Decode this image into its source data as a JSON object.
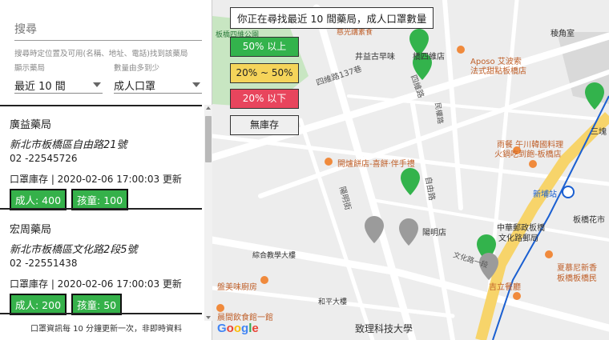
{
  "search": {
    "placeholder": "搜尋",
    "hint": "搜尋時定位置及可用(名稱、地址、電話)找到該藥局"
  },
  "filters": {
    "display": {
      "label": "顯示藥局",
      "value": "最近 10 間"
    },
    "sort": {
      "label": "數量由多到少",
      "value": "成人口罩"
    }
  },
  "stores": [
    {
      "name": "廣益藥局",
      "address": "新北市板橋區自由路21號",
      "phone": "02 -22545726",
      "update": "口罩庫存 | 2020-02-06 17:00:03 更新",
      "adult": "成人: 400",
      "child": "孩童: 100"
    },
    {
      "name": "宏周藥局",
      "address": "新北市板橋區文化路2段5號",
      "phone": "02 -22551438",
      "update": "口罩庫存 | 2020-02-06 17:00:03 更新",
      "adult": "成人: 200",
      "child": "孩童: 50"
    }
  ],
  "footer": "口罩資訊每 10 分鐘更新一次，非即時資料",
  "map": {
    "title": "你正在尋找最近 10 間藥局，成人口罩數量",
    "legend": {
      "green": "50% 以上",
      "yellow": "20% ~ 50%",
      "red": "20% 以下",
      "none": "無庫存"
    },
    "legend_colors": {
      "green": "#33b34c",
      "yellow": "#f5d45a",
      "red": "#e8455d",
      "none": "#efefef"
    },
    "labels": {
      "l1": "四維路137巷",
      "l2": "井益古早味",
      "l3": "橋四維店",
      "l4": "四維路",
      "l5": "Aposo 艾波索",
      "l6": "法式甜點板橋店",
      "l7": "稜角室",
      "l8": "開爐餅店-喜餅·伴手禮",
      "l9": "自由路",
      "l10": "陽明街",
      "l11": "陽明店",
      "l12": "中華郵政板橋",
      "l13": "文化路郵局",
      "l14": "新埔站",
      "l15": "雨餐 午川韓國料理",
      "l16": "火鍋吃到飽-板橋店",
      "l17": "綜合教學大樓",
      "l18": "和平大樓",
      "l19": "盤美味廚房",
      "l20": "晨間飲食館一館",
      "l21": "致理科技大學",
      "l22": "吉立餐廳",
      "l23": "夏慕尼新香",
      "l24": "板橋板橋民",
      "l25": "板橋花市",
      "l26": "文化路一段",
      "l27": "民權路",
      "l28": "板橋四維公園",
      "l29": "慈光講素食",
      "l30": "三塊"
    },
    "google": [
      "G",
      "o",
      "o",
      "g",
      "l",
      "e"
    ]
  }
}
